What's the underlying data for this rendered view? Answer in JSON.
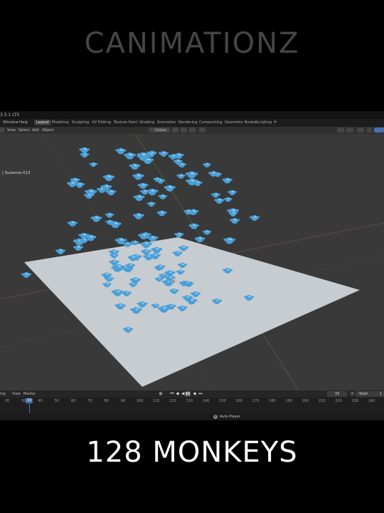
{
  "brand": "CANIMATIONZ",
  "caption": "128 MONKEYS",
  "app": {
    "version": "3.5.1 LTS",
    "menu": [
      "Window",
      "Help"
    ],
    "workspace_tabs": [
      {
        "label": "Layout",
        "active": true
      },
      {
        "label": "Modeling"
      },
      {
        "label": "Sculpting"
      },
      {
        "label": "UV Editing"
      },
      {
        "label": "Texture Paint"
      },
      {
        "label": "Shading"
      },
      {
        "label": "Animation"
      },
      {
        "label": "Rendering"
      },
      {
        "label": "Compositing"
      },
      {
        "label": "Geometry Nodes"
      },
      {
        "label": "Scripting"
      }
    ],
    "add_tab": "+",
    "viewport_menu": [
      "View",
      "Select",
      "Add",
      "Object"
    ],
    "transform_orientation": "Global",
    "active_object": "| Suzanne.013",
    "colors": {
      "monkey": "#4b9fd6",
      "plane": "#c6ccd0",
      "accent": "#4772b3"
    }
  },
  "timeline": {
    "menu": [
      "ing",
      "View",
      "Marker"
    ],
    "current_frame": "33",
    "current_frame_marker": "33",
    "start_label": "Start",
    "start_value": "1",
    "ticks": [
      "20",
      "30",
      "40",
      "50",
      "60",
      "70",
      "80",
      "90",
      "100",
      "110",
      "120",
      "130",
      "140",
      "150",
      "160",
      "170",
      "180",
      "190",
      "200",
      "210",
      "220",
      "230",
      "240"
    ],
    "icons": [
      "jump-start-icon",
      "prev-key-icon",
      "play-reverse-icon",
      "pause-icon",
      "next-key-icon",
      "jump-end-icon"
    ]
  },
  "status": {
    "auto_player": "Auto Player"
  }
}
